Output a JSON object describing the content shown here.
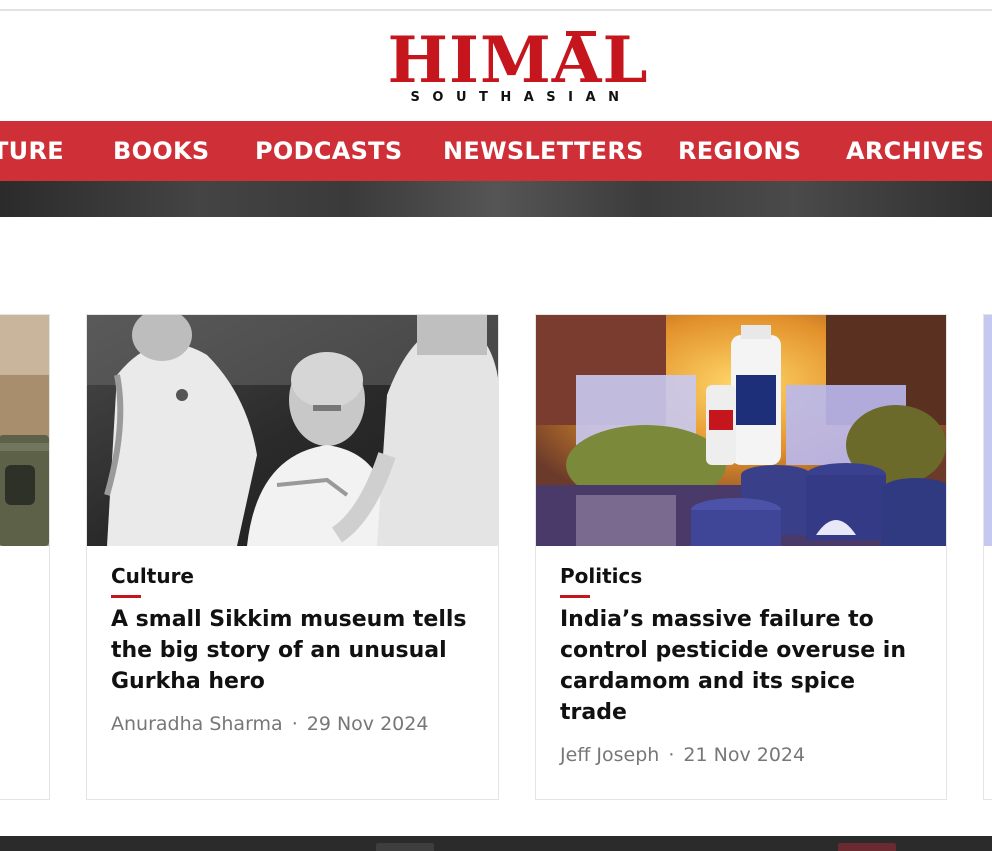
{
  "brand": {
    "logo_main": "HIMAL",
    "logo_sub": "SOUTHASIAN",
    "color": "#c4161c"
  },
  "nav": {
    "items": [
      {
        "label": "TURE"
      },
      {
        "label": "BOOKS"
      },
      {
        "label": "PODCASTS"
      },
      {
        "label": "NEWSLETTERS"
      },
      {
        "label": "REGIONS"
      },
      {
        "label": "ARCHIVES"
      }
    ],
    "color": "#cf3038"
  },
  "cards": [
    {
      "category": "Culture",
      "title": "A small Sikkim museum tells the big story of an unusual Gurkha hero",
      "author": "Anuradha Sharma",
      "date": "29 Nov 2024",
      "image_icon": "archival-photo-nurses-icon"
    },
    {
      "category": "Politics",
      "title": "India’s massive failure to control pesticide overuse in cardamom and its spice trade",
      "author": "Jeff Joseph",
      "date": "21 Nov 2024",
      "image_icon": "pesticide-collage-icon"
    }
  ],
  "meta_separator": "·"
}
